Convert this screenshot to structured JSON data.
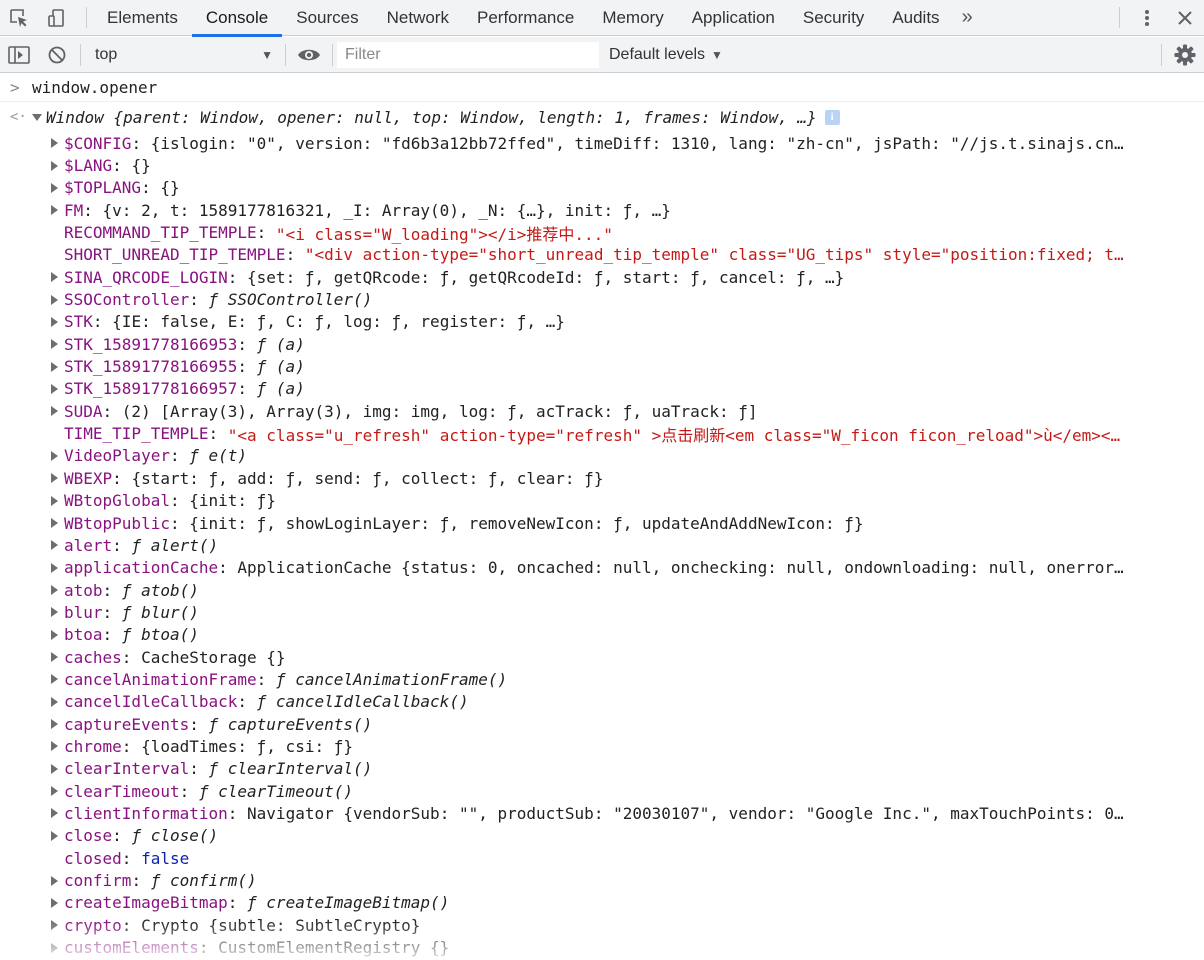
{
  "tabs": [
    "Elements",
    "Console",
    "Sources",
    "Network",
    "Performance",
    "Memory",
    "Application",
    "Security",
    "Audits"
  ],
  "active_tab": "Console",
  "more_tabs_glyph": "»",
  "toolbar": {
    "context": "top",
    "filter_placeholder": "Filter",
    "levels": "Default levels"
  },
  "command": "window.opener",
  "result": {
    "summary": "Window {parent: Window, opener: null, top: Window, length: 1, frames: Window, …}"
  },
  "properties": [
    {
      "name": "$CONFIG",
      "value": "{islogin: \"0\", version: \"fd6b3a12bb72ffed\", timeDiff: 1310, lang: \"zh-cn\", jsPath: \"//js.t.sinajs.cn…",
      "expandable": true,
      "kind": "obj"
    },
    {
      "name": "$LANG",
      "value": "{}",
      "expandable": true,
      "kind": "obj"
    },
    {
      "name": "$TOPLANG",
      "value": "{}",
      "expandable": true,
      "kind": "obj"
    },
    {
      "name": "FM",
      "value": "{v: 2, t: 1589177816321, _I: Array(0), _N: {…}, init: ƒ, …}",
      "expandable": true,
      "kind": "obj"
    },
    {
      "name": "RECOMMAND_TIP_TEMPLE",
      "value": "\"<i class=\"W_loading\"></i>推荐中...\"",
      "expandable": false,
      "kind": "str"
    },
    {
      "name": "SHORT_UNREAD_TIP_TEMPLE",
      "value": "\"<div action-type=\"short_unread_tip_temple\" class=\"UG_tips\" style=\"position:fixed; t…",
      "expandable": false,
      "kind": "str"
    },
    {
      "name": "SINA_QRCODE_LOGIN",
      "value": "{set: ƒ, getQRcode: ƒ, getQRcodeId: ƒ, start: ƒ, cancel: ƒ, …}",
      "expandable": true,
      "kind": "obj"
    },
    {
      "name": "SSOController",
      "value": "ƒ SSOController()",
      "expandable": true,
      "kind": "fn"
    },
    {
      "name": "STK",
      "value": "{IE: false, E: ƒ, C: ƒ, log: ƒ, register: ƒ, …}",
      "expandable": true,
      "kind": "obj"
    },
    {
      "name": "STK_15891778166953",
      "value": "ƒ (a)",
      "expandable": true,
      "kind": "fn"
    },
    {
      "name": "STK_15891778166955",
      "value": "ƒ (a)",
      "expandable": true,
      "kind": "fn"
    },
    {
      "name": "STK_15891778166957",
      "value": "ƒ (a)",
      "expandable": true,
      "kind": "fn"
    },
    {
      "name": "SUDA",
      "value": "(2) [Array(3), Array(3), img: img, log: ƒ, acTrack: ƒ, uaTrack: ƒ]",
      "expandable": true,
      "kind": "obj"
    },
    {
      "name": "TIME_TIP_TEMPLE",
      "value": "\"<a class=\"u_refresh\" action-type=\"refresh\" >点击刷新<em class=\"W_ficon ficon_reload\">ù</em><…",
      "expandable": false,
      "kind": "str"
    },
    {
      "name": "VideoPlayer",
      "value": "ƒ e(t)",
      "expandable": true,
      "kind": "fn"
    },
    {
      "name": "WBEXP",
      "value": "{start: ƒ, add: ƒ, send: ƒ, collect: ƒ, clear: ƒ}",
      "expandable": true,
      "kind": "obj"
    },
    {
      "name": "WBtopGlobal",
      "value": "{init: ƒ}",
      "expandable": true,
      "kind": "obj"
    },
    {
      "name": "WBtopPublic",
      "value": "{init: ƒ, showLoginLayer: ƒ, removeNewIcon: ƒ, updateAndAddNewIcon: ƒ}",
      "expandable": true,
      "kind": "obj"
    },
    {
      "name": "alert",
      "value": "ƒ alert()",
      "expandable": true,
      "kind": "fn"
    },
    {
      "name": "applicationCache",
      "value": "ApplicationCache {status: 0, oncached: null, onchecking: null, ondownloading: null, onerror…",
      "expandable": true,
      "kind": "obj"
    },
    {
      "name": "atob",
      "value": "ƒ atob()",
      "expandable": true,
      "kind": "fn"
    },
    {
      "name": "blur",
      "value": "ƒ blur()",
      "expandable": true,
      "kind": "fn"
    },
    {
      "name": "btoa",
      "value": "ƒ btoa()",
      "expandable": true,
      "kind": "fn"
    },
    {
      "name": "caches",
      "value": "CacheStorage {}",
      "expandable": true,
      "kind": "obj"
    },
    {
      "name": "cancelAnimationFrame",
      "value": "ƒ cancelAnimationFrame()",
      "expandable": true,
      "kind": "fn"
    },
    {
      "name": "cancelIdleCallback",
      "value": "ƒ cancelIdleCallback()",
      "expandable": true,
      "kind": "fn"
    },
    {
      "name": "captureEvents",
      "value": "ƒ captureEvents()",
      "expandable": true,
      "kind": "fn"
    },
    {
      "name": "chrome",
      "value": "{loadTimes: ƒ, csi: ƒ}",
      "expandable": true,
      "kind": "obj"
    },
    {
      "name": "clearInterval",
      "value": "ƒ clearInterval()",
      "expandable": true,
      "kind": "fn"
    },
    {
      "name": "clearTimeout",
      "value": "ƒ clearTimeout()",
      "expandable": true,
      "kind": "fn"
    },
    {
      "name": "clientInformation",
      "value": "Navigator {vendorSub: \"\", productSub: \"20030107\", vendor: \"Google Inc.\", maxTouchPoints: 0…",
      "expandable": true,
      "kind": "obj"
    },
    {
      "name": "close",
      "value": "ƒ close()",
      "expandable": true,
      "kind": "fn"
    },
    {
      "name": "closed",
      "value": "false",
      "expandable": false,
      "kind": "kw"
    },
    {
      "name": "confirm",
      "value": "ƒ confirm()",
      "expandable": true,
      "kind": "fn"
    },
    {
      "name": "createImageBitmap",
      "value": "ƒ createImageBitmap()",
      "expandable": true,
      "kind": "fn"
    },
    {
      "name": "crypto",
      "value": "Crypto {subtle: SubtleCrypto}",
      "expandable": true,
      "kind": "obj"
    },
    {
      "name": "customElements",
      "value": "CustomElementRegistry {}",
      "expandable": true,
      "kind": "obj"
    }
  ]
}
